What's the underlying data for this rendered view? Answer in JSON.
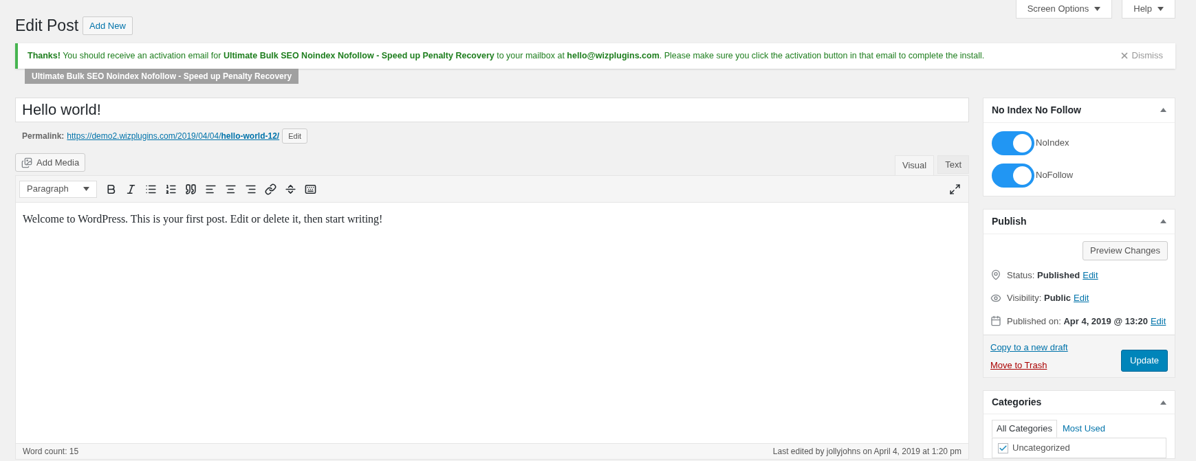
{
  "header_buttons": [
    {
      "label": "Screen Options"
    },
    {
      "label": "Help"
    }
  ],
  "page_title": "Edit Post",
  "add_new": "Add New",
  "notice": {
    "text": "**Thanks!** You should receive an activation email for **Ultimate Bulk SEO Noindex Nofollow - Speed up Penalty Recovery** to your mailbox at **hello@wizplugins.com**. Please make sure you click the activation button in that email to complete the install.",
    "dismiss": "Dismiss"
  },
  "plugin_tag": "Ultimate Bulk SEO Noindex Nofollow - Speed up Penalty Recovery",
  "post_title": "Hello world!",
  "permalink": {
    "label": "Permalink:",
    "url": "https://demo2.wizplugins.com/2019/04/04/**hello-world-12/**",
    "edit": "Edit"
  },
  "add_media": "Add Media",
  "editor_tabs": [
    {
      "label": "Visual",
      "selected": true
    },
    {
      "label": "Text",
      "selected": false
    }
  ],
  "format_select": "Paragraph",
  "content": "Welcome to WordPress. This is your first post. Edit or delete it, then start writing!",
  "word_count": "Word count: 15",
  "last_edited": "Last edited by jollyjohns on April 4, 2019 at 1:20 pm",
  "noindex_box": {
    "title": "No Index No Follow",
    "toggles": [
      {
        "label": "NoIndex",
        "on": true
      },
      {
        "label": "NoFollow",
        "on": true
      }
    ]
  },
  "publish_box": {
    "title": "Publish",
    "preview": "Preview Changes",
    "rows": [
      {
        "kind": "status",
        "label": "Status:",
        "value": "Published",
        "link": "Edit"
      },
      {
        "kind": "visibility",
        "label": "Visibility:",
        "value": "Public",
        "link": "Edit"
      },
      {
        "kind": "date",
        "label": "Published on:",
        "value": "Apr 4, 2019 @ 13:20",
        "link": "Edit"
      }
    ],
    "copy_draft": "Copy to a new draft",
    "trash": "Move to Trash",
    "update": "Update"
  },
  "categories_box": {
    "title": "Categories",
    "tabs": [
      {
        "label": "All Categories",
        "selected": true
      },
      {
        "label": "Most Used",
        "selected": false
      }
    ],
    "items": [
      {
        "label": "Uncategorized",
        "checked": true
      }
    ]
  }
}
